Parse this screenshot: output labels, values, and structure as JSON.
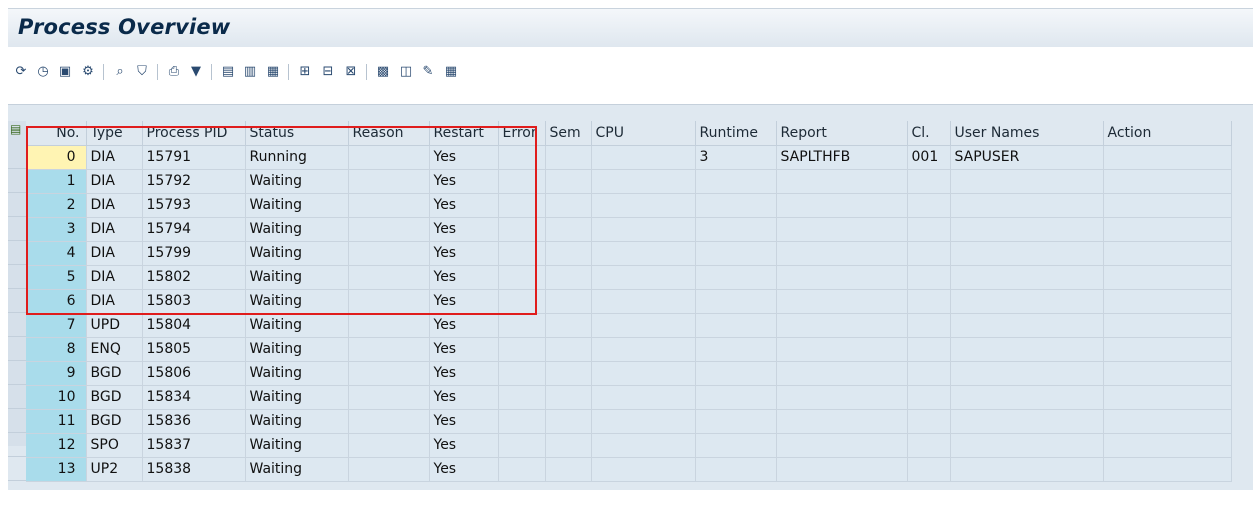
{
  "header": {
    "title": "Process Overview"
  },
  "toolbar": {
    "icons": [
      {
        "name": "refresh-icon",
        "glyph": "⟳"
      },
      {
        "name": "clock-icon",
        "glyph": "◷"
      },
      {
        "name": "detail-icon",
        "glyph": "▣"
      },
      {
        "name": "settings-icon",
        "glyph": "⚙"
      },
      {
        "name": "find-icon",
        "glyph": "⌕"
      },
      {
        "name": "filter-icon",
        "glyph": "⛉"
      },
      {
        "name": "print-icon",
        "glyph": "⎙"
      },
      {
        "name": "sum-icon",
        "glyph": "▼"
      },
      {
        "name": "export-icon",
        "glyph": "▤"
      },
      {
        "name": "export2-icon",
        "glyph": "▥"
      },
      {
        "name": "export3-icon",
        "glyph": "▦"
      },
      {
        "name": "layout-icon",
        "glyph": "⊞"
      },
      {
        "name": "layout-change-icon",
        "glyph": "⊟"
      },
      {
        "name": "layout-save-icon",
        "glyph": "⊠"
      },
      {
        "name": "info-icon",
        "glyph": "▩"
      },
      {
        "name": "copy-icon",
        "glyph": "◫"
      },
      {
        "name": "edit-icon",
        "glyph": "✎"
      },
      {
        "name": "calculator-icon",
        "glyph": "▦"
      }
    ]
  },
  "table": {
    "columns": [
      "No.",
      "Type",
      "Process PID",
      "Status",
      "Reason",
      "Restart",
      "Error",
      "Sem",
      "CPU",
      "Runtime",
      "Report",
      "Cl.",
      "User Names",
      "Action"
    ],
    "rows": [
      {
        "no": "0",
        "type": "DIA",
        "pid": "15791",
        "status": "Running",
        "reason": "",
        "restart": "Yes",
        "error": "",
        "sem": "",
        "cpu": "",
        "runtime": "3",
        "report": "SAPLTHFB",
        "cl": "001",
        "user": "SAPUSER",
        "action": ""
      },
      {
        "no": "1",
        "type": "DIA",
        "pid": "15792",
        "status": "Waiting",
        "reason": "",
        "restart": "Yes",
        "error": "",
        "sem": "",
        "cpu": "",
        "runtime": "",
        "report": "",
        "cl": "",
        "user": "",
        "action": ""
      },
      {
        "no": "2",
        "type": "DIA",
        "pid": "15793",
        "status": "Waiting",
        "reason": "",
        "restart": "Yes",
        "error": "",
        "sem": "",
        "cpu": "",
        "runtime": "",
        "report": "",
        "cl": "",
        "user": "",
        "action": ""
      },
      {
        "no": "3",
        "type": "DIA",
        "pid": "15794",
        "status": "Waiting",
        "reason": "",
        "restart": "Yes",
        "error": "",
        "sem": "",
        "cpu": "",
        "runtime": "",
        "report": "",
        "cl": "",
        "user": "",
        "action": ""
      },
      {
        "no": "4",
        "type": "DIA",
        "pid": "15799",
        "status": "Waiting",
        "reason": "",
        "restart": "Yes",
        "error": "",
        "sem": "",
        "cpu": "",
        "runtime": "",
        "report": "",
        "cl": "",
        "user": "",
        "action": ""
      },
      {
        "no": "5",
        "type": "DIA",
        "pid": "15802",
        "status": "Waiting",
        "reason": "",
        "restart": "Yes",
        "error": "",
        "sem": "",
        "cpu": "",
        "runtime": "",
        "report": "",
        "cl": "",
        "user": "",
        "action": ""
      },
      {
        "no": "6",
        "type": "DIA",
        "pid": "15803",
        "status": "Waiting",
        "reason": "",
        "restart": "Yes",
        "error": "",
        "sem": "",
        "cpu": "",
        "runtime": "",
        "report": "",
        "cl": "",
        "user": "",
        "action": ""
      },
      {
        "no": "7",
        "type": "UPD",
        "pid": "15804",
        "status": "Waiting",
        "reason": "",
        "restart": "Yes",
        "error": "",
        "sem": "",
        "cpu": "",
        "runtime": "",
        "report": "",
        "cl": "",
        "user": "",
        "action": ""
      },
      {
        "no": "8",
        "type": "ENQ",
        "pid": "15805",
        "status": "Waiting",
        "reason": "",
        "restart": "Yes",
        "error": "",
        "sem": "",
        "cpu": "",
        "runtime": "",
        "report": "",
        "cl": "",
        "user": "",
        "action": ""
      },
      {
        "no": "9",
        "type": "BGD",
        "pid": "15806",
        "status": "Waiting",
        "reason": "",
        "restart": "Yes",
        "error": "",
        "sem": "",
        "cpu": "",
        "runtime": "",
        "report": "",
        "cl": "",
        "user": "",
        "action": ""
      },
      {
        "no": "10",
        "type": "BGD",
        "pid": "15834",
        "status": "Waiting",
        "reason": "",
        "restart": "Yes",
        "error": "",
        "sem": "",
        "cpu": "",
        "runtime": "",
        "report": "",
        "cl": "",
        "user": "",
        "action": ""
      },
      {
        "no": "11",
        "type": "BGD",
        "pid": "15836",
        "status": "Waiting",
        "reason": "",
        "restart": "Yes",
        "error": "",
        "sem": "",
        "cpu": "",
        "runtime": "",
        "report": "",
        "cl": "",
        "user": "",
        "action": ""
      },
      {
        "no": "12",
        "type": "SPO",
        "pid": "15837",
        "status": "Waiting",
        "reason": "",
        "restart": "Yes",
        "error": "",
        "sem": "",
        "cpu": "",
        "runtime": "",
        "report": "",
        "cl": "",
        "user": "",
        "action": ""
      },
      {
        "no": "13",
        "type": "UP2",
        "pid": "15838",
        "status": "Waiting",
        "reason": "",
        "restart": "Yes",
        "error": "",
        "sem": "",
        "cpu": "",
        "runtime": "",
        "report": "",
        "cl": "",
        "user": "",
        "action": ""
      }
    ]
  },
  "colors": {
    "selected_cell": "#fff4b3",
    "number_cell": "#a9dceb",
    "highlight": "#e01c1c"
  }
}
